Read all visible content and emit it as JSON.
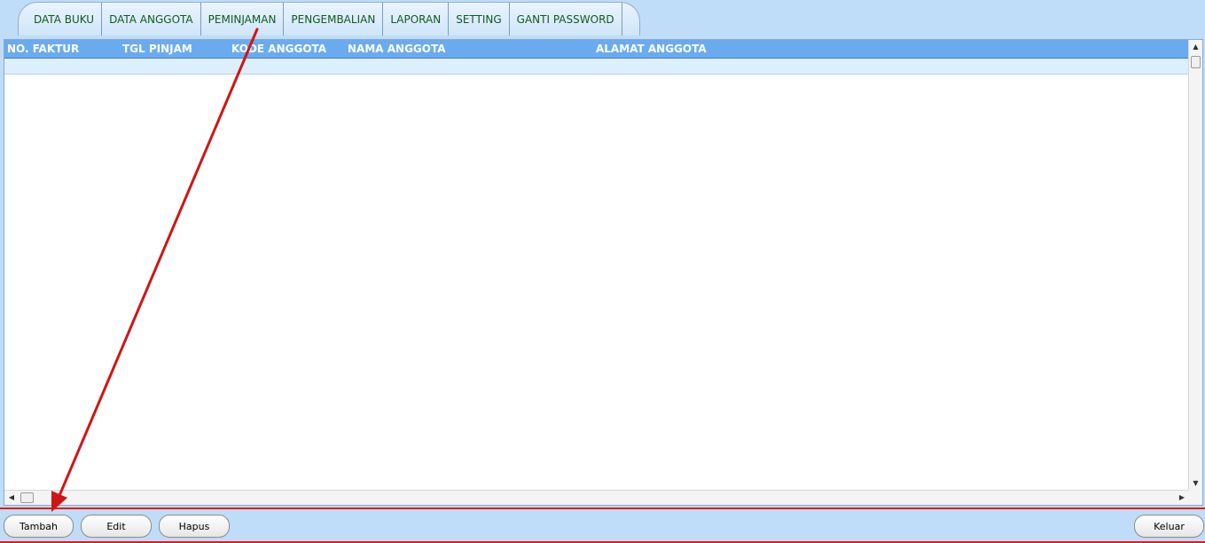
{
  "tabs": [
    {
      "label": "DATA BUKU"
    },
    {
      "label": "DATA ANGGOTA"
    },
    {
      "label": "PEMINJAMAN"
    },
    {
      "label": "PENGEMBALIAN"
    },
    {
      "label": "LAPORAN"
    },
    {
      "label": "SETTING"
    },
    {
      "label": "GANTI PASSWORD"
    }
  ],
  "grid": {
    "columns": [
      {
        "label": "NO. FAKTUR"
      },
      {
        "label": "TGL PINJAM"
      },
      {
        "label": "KODE ANGGOTA"
      },
      {
        "label": "NAMA ANGGOTA"
      },
      {
        "label": "ALAMAT ANGGOTA"
      }
    ],
    "rows": [],
    "scrollbar_icons": {
      "up": "scroll-up-arrow-icon",
      "down": "scroll-down-arrow-icon",
      "left": "scroll-left-arrow-icon",
      "right": "scroll-right-arrow-icon"
    }
  },
  "buttons": {
    "tambah": "Tambah",
    "edit": "Edit",
    "hapus": "Hapus",
    "keluar": "Keluar"
  },
  "annotation": {
    "icon": "red-arrow-annotation",
    "color": "#d01515"
  },
  "colors": {
    "background": "#bfdcf8",
    "header": "#6aabf0",
    "tab_text": "#0f5a1d",
    "accent_line": "#e01b1b"
  }
}
